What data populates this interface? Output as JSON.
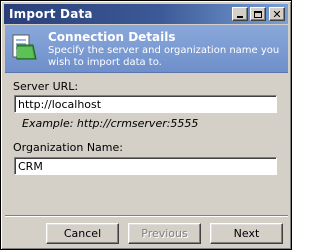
{
  "window": {
    "title": "Import Data"
  },
  "header": {
    "title": "Connection Details",
    "subtitle": "Specify the server and organization name you wish to import data to.",
    "icon": "folder-document-icon"
  },
  "form": {
    "server_url_label": "Server URL:",
    "server_url_value": "http://localhost",
    "server_url_example": "Example: http://crmserver:5555",
    "org_name_label": "Organization Name:",
    "org_name_value": "CRM"
  },
  "buttons": {
    "cancel": "Cancel",
    "previous": "Previous",
    "next": "Next"
  },
  "colors": {
    "header_bg": "#7f9ed2",
    "titlebar_bg": "#2a3f7a",
    "face": "#d4d0c8"
  }
}
